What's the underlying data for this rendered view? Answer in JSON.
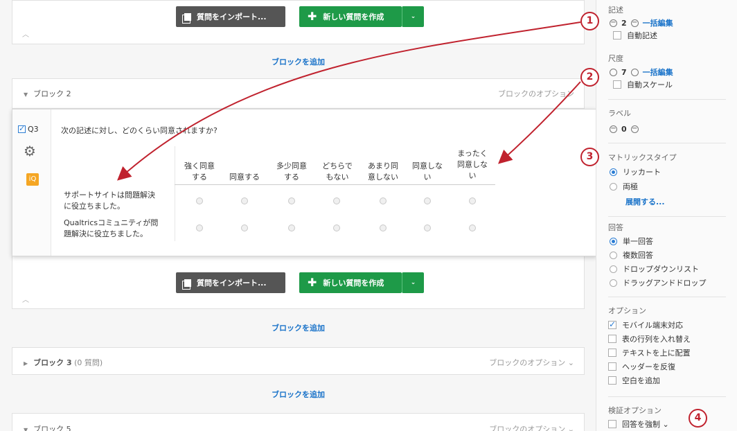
{
  "buttons": {
    "import_label": "質問をインポート...",
    "create_label": "新しい質問を作成",
    "caret": "⌄"
  },
  "add_block": "ブロックを追加",
  "block2": {
    "name": "ブロック 2",
    "options": "ブロックのオプション"
  },
  "block3": {
    "name": "ブロック 3",
    "count": "(0 質問)",
    "options": "ブロックのオプション ⌄"
  },
  "block5": {
    "name": "ブロック 5",
    "options": "ブロックのオプション ⌄"
  },
  "question": {
    "id": "Q3",
    "text": "次の記述に対し、どのくらい同意されますか?",
    "columns": [
      [
        "強く同意",
        "する"
      ],
      [
        "",
        "同意する"
      ],
      [
        "多少同意",
        "する"
      ],
      [
        "どちらで",
        "もない"
      ],
      [
        "あまり同",
        "意しない"
      ],
      [
        "同意しな",
        "い"
      ],
      [
        "まったく",
        "同意しな",
        "い"
      ]
    ],
    "rows": [
      [
        "サポートサイトは問題解決",
        "に役立ちました。"
      ],
      [
        "Qualtricsコミュニティが問",
        "題解決に役立ちました。"
      ]
    ]
  },
  "sidebar": {
    "statements": {
      "title": "記述",
      "value": "2",
      "bulk": "一括編集",
      "auto": "自動記述"
    },
    "scale": {
      "title": "尺度",
      "value": "7",
      "bulk": "一括編集",
      "auto": "自動スケール"
    },
    "labels": {
      "title": "ラベル",
      "value": "0"
    },
    "matrix_type": {
      "title": "マトリックスタイプ",
      "options": [
        "リッカート",
        "両極"
      ],
      "expand": "展開する..."
    },
    "answers": {
      "title": "回答",
      "options": [
        "単一回答",
        "複数回答",
        "ドロップダウンリスト",
        "ドラッグアンドドロップ"
      ]
    },
    "options": {
      "title": "オプション",
      "items": [
        "モバイル端末対応",
        "表の行列を入れ替え",
        "テキストを上に配置",
        "ヘッダーを反復",
        "空白を追加"
      ]
    },
    "validation": {
      "title": "検証オプション",
      "force": "回答を強制 ⌄"
    }
  },
  "callouts": [
    "1",
    "2",
    "3",
    "4"
  ],
  "colors": {
    "accent": "#1a73c9",
    "green": "#1e9a48",
    "callout": "#c0222e"
  }
}
